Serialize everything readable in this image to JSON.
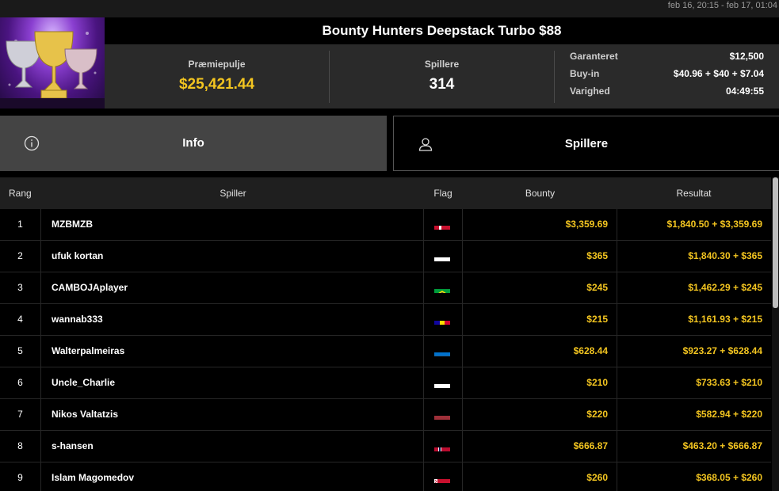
{
  "header": {
    "dates": "feb 16, 20:15 - feb 17, 01:04",
    "title": "Bounty Hunters Deepstack Turbo $88"
  },
  "stats": {
    "prize_label": "Præmiepulje",
    "prize_value": "$25,421.44",
    "players_label": "Spillere",
    "players_value": "314",
    "details": [
      {
        "key": "Garanteret",
        "value": "$12,500"
      },
      {
        "key": "Buy-in",
        "value": "$40.96 + $40 + $7.04"
      },
      {
        "key": "Varighed",
        "value": "04:49:55"
      }
    ]
  },
  "tabs": {
    "info_label": "Info",
    "players_label": "Spillere"
  },
  "table": {
    "headers": {
      "rank": "Rang",
      "player": "Spiller",
      "flag": "Flag",
      "bounty": "Bounty",
      "result": "Resultat"
    },
    "rows": [
      {
        "rank": "1",
        "name": "MZBMZB",
        "flag": "denmark",
        "bounty": "$3,359.69",
        "result": "$1,840.50 + $3,359.69"
      },
      {
        "rank": "2",
        "name": "ufuk kortan",
        "flag": "cyprus",
        "bounty": "$365",
        "result": "$1,840.30 + $365"
      },
      {
        "rank": "3",
        "name": "CAMBOJAplayer",
        "flag": "brazil",
        "bounty": "$245",
        "result": "$1,462.29 + $245"
      },
      {
        "rank": "4",
        "name": "wannab333",
        "flag": "andorra",
        "bounty": "$215",
        "result": "$1,161.93 + $215"
      },
      {
        "rank": "5",
        "name": "Walterpalmeiras",
        "flag": "estonia",
        "bounty": "$628.44",
        "result": "$923.27 + $628.44"
      },
      {
        "rank": "6",
        "name": "Uncle_Charlie",
        "flag": "poland",
        "bounty": "$210",
        "result": "$733.63 + $210"
      },
      {
        "rank": "7",
        "name": "Nikos Valtatzis",
        "flag": "latvia",
        "bounty": "$220",
        "result": "$582.94 + $220"
      },
      {
        "rank": "8",
        "name": "s-hansen",
        "flag": "norway",
        "bounty": "$666.87",
        "result": "$463.20 + $666.87"
      },
      {
        "rank": "9",
        "name": "Islam Magomedov",
        "flag": "belarus",
        "bounty": "$260",
        "result": "$368.05 + $260"
      }
    ]
  },
  "colors": {
    "accent": "#f3c520",
    "tab_active": "#444444"
  }
}
